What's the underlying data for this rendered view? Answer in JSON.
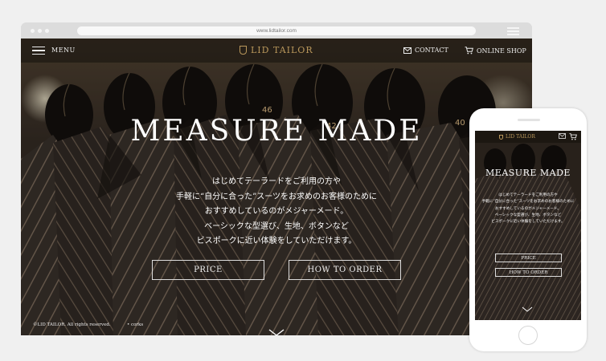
{
  "browser": {
    "url": "www.lidtailor.com"
  },
  "header": {
    "menu_label": "MENU",
    "logo_text": "LID TAILOR",
    "contact_label": "CONTACT",
    "shop_label": "ONLINE SHOP"
  },
  "hero": {
    "title": "MEASURE MADE",
    "lines": [
      "はじめてテーラードをご利用の方や",
      "手軽に“自分に合った”スーツをお求めのお客様のために",
      "おすすめしているのがメジャーメード。",
      "ベーシックな型選び、生地、ボタンなど",
      "ビスポークに近い体験をしていただけます。"
    ],
    "price_button": "PRICE",
    "order_button": "HOW TO ORDER"
  },
  "footer": {
    "copyright": "©LID TAILOR. All rights reserved.",
    "credit": "• corks"
  },
  "mobile": {
    "logo_text": "LID TAILOR",
    "title": "MEASURE MADE",
    "lines": [
      "はじめてテーラードをご利用の方や",
      "手軽に“自分に合った”スーツをお求めのお客様のために",
      "おすすめしているのがメジャーメード。",
      "ベーシックな型選び、生地、ボタンなど",
      "ビスポークに近い体験をしていただけます。"
    ],
    "price_button": "PRICE",
    "order_button": "HOW TO ORDER"
  },
  "colors": {
    "accent_gold": "#b9975b",
    "header_overlay": "rgba(20,16,12,0.55)"
  }
}
